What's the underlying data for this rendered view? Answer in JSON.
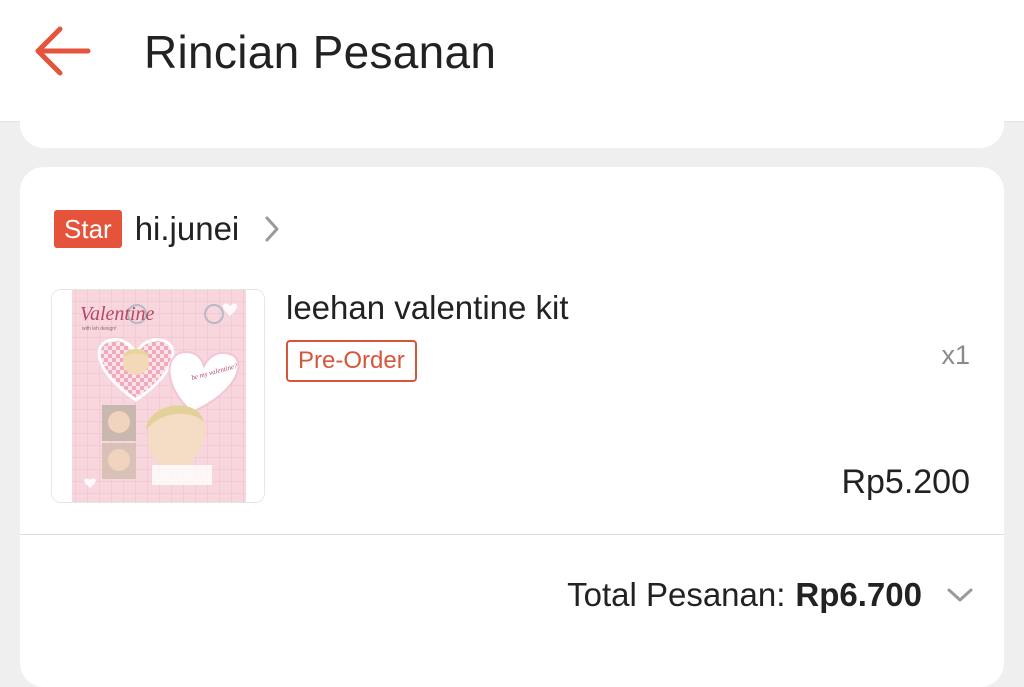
{
  "header": {
    "title": "Rincian Pesanan",
    "back_icon": "arrow-left-icon",
    "accent_color": "#e5533a"
  },
  "order": {
    "shop": {
      "badge": "Star",
      "name": "hi.junei",
      "chevron_icon": "chevron-right-icon"
    },
    "product": {
      "name": "leehan valentine kit",
      "tag": "Pre-Order",
      "quantity": "x1",
      "price": "Rp5.200",
      "thumbnail": {
        "title": "Valentine",
        "subtitle": "with leh design!",
        "heart_text": "be my valentine?"
      }
    },
    "total": {
      "label": "Total Pesanan:",
      "value": "Rp6.700",
      "chevron_icon": "chevron-down-icon"
    }
  }
}
